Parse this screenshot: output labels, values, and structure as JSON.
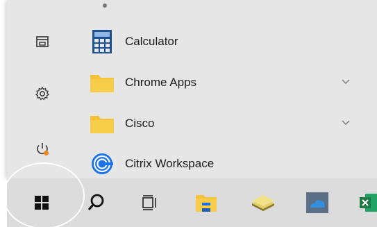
{
  "start_menu": {
    "rail": {
      "icons": [
        "documents-icon",
        "settings-icon",
        "power-icon"
      ]
    },
    "apps": [
      {
        "label": "Calculator",
        "icon": "calculator-icon",
        "expandable": false
      },
      {
        "label": "Chrome Apps",
        "icon": "folder-icon",
        "expandable": true
      },
      {
        "label": "Cisco",
        "icon": "folder-icon",
        "expandable": true
      },
      {
        "label": "Citrix Workspace",
        "icon": "citrix-icon",
        "expandable": false
      }
    ]
  },
  "taskbar": {
    "items": [
      "windows-start-icon",
      "search-icon",
      "task-view-icon",
      "file-explorer-icon",
      "stack-app-icon",
      "onedrive-app-icon",
      "excel-icon"
    ]
  },
  "colors": {
    "accent_blue": "#1a73e8",
    "folder_yellow": "#f3c13a",
    "power_orange": "#f08a24",
    "excel_green": "#1f7a45"
  }
}
